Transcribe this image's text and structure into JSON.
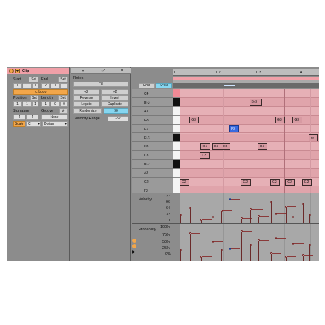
{
  "clip": {
    "title": "Clip",
    "start_label": "Start",
    "end_label": "End",
    "set_label": "Set",
    "start": [
      "1",
      "1",
      "1"
    ],
    "end": [
      "2",
      "1",
      "1"
    ],
    "loop_label": "Loop",
    "position_label": "Position",
    "length_label": "Length",
    "position": [
      "1",
      "1",
      "1"
    ],
    "length": [
      "1",
      "0",
      "0"
    ],
    "signature_label": "Signature",
    "groove_label": "Groove",
    "signature": [
      "4",
      "4"
    ],
    "groove_value": "None",
    "scale_label": "Scale",
    "scale_root": "C",
    "scale_mode": "Dorian"
  },
  "notes_panel": {
    "title": "Notes",
    "pitch_value": "F3",
    "plus2": "÷2",
    "times2": "×2",
    "reverse": "Reverse",
    "invert": "Invert",
    "legato": "Legato",
    "duplicate": "Duplicate",
    "randomize": "Randomize",
    "randomize_value": "90",
    "velocity_range_label": "Velocity Range",
    "velocity_range_value": "-52"
  },
  "editor": {
    "fold_label": "Fold",
    "scale_label": "Scale",
    "ruler": [
      "1",
      "1.2",
      "1.3",
      "1.4"
    ],
    "keys": [
      "C4",
      "B♭3",
      "A3",
      "G3",
      "F3",
      "E♭3",
      "D3",
      "C3",
      "B♭2",
      "A2",
      "G2",
      "F2"
    ],
    "notes": [
      {
        "label": "B♭3",
        "row": 1,
        "start": 0.5,
        "len": 0.09
      },
      {
        "label": "G3",
        "row": 3,
        "start": 0.07,
        "len": 0.07
      },
      {
        "label": "G3",
        "row": 3,
        "start": 0.685,
        "len": 0.07
      },
      {
        "label": "G3",
        "row": 3,
        "start": 0.81,
        "len": 0.07
      },
      {
        "label": "F3",
        "row": 4,
        "start": 0.355,
        "len": 0.07,
        "selected": true
      },
      {
        "label": "E♭",
        "row": 5,
        "start": 0.925,
        "len": 0.07
      },
      {
        "label": "D3",
        "row": 6,
        "start": 0.15,
        "len": 0.07
      },
      {
        "label": "D3",
        "row": 6,
        "start": 0.23,
        "len": 0.07
      },
      {
        "label": "D3",
        "row": 6,
        "start": 0.295,
        "len": 0.07
      },
      {
        "label": "D3",
        "row": 6,
        "start": 0.56,
        "len": 0.07
      },
      {
        "label": "C3",
        "row": 7,
        "start": 0.145,
        "len": 0.07
      },
      {
        "label": "G2",
        "row": 10,
        "start": 0.0,
        "len": 0.07
      },
      {
        "label": "G2",
        "row": 10,
        "start": 0.44,
        "len": 0.07
      },
      {
        "label": "G2",
        "row": 10,
        "start": 0.65,
        "len": 0.07
      },
      {
        "label": "G2",
        "row": 10,
        "start": 0.76,
        "len": 0.07
      },
      {
        "label": "G2",
        "row": 10,
        "start": 0.88,
        "len": 0.07
      }
    ]
  },
  "velocity": {
    "title": "Velocity",
    "ticks": [
      "127",
      "96",
      "64",
      "32",
      "1"
    ]
  },
  "probability": {
    "title": "Probability",
    "ticks": [
      "100%",
      "75%",
      "50%",
      "25%",
      "0%"
    ]
  },
  "colors": {
    "accent_orange": "#f2a64a",
    "selected_note": "#3a6ae0",
    "scale_highlight": "#e8a0a8"
  }
}
